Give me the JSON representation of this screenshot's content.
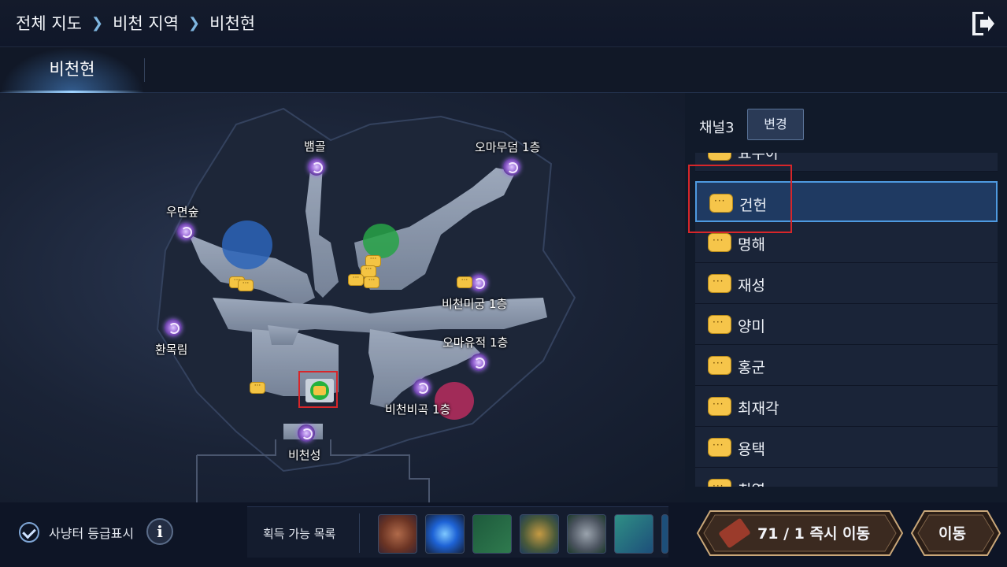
{
  "breadcrumb": [
    "전체 지도",
    "비천 지역",
    "비천현"
  ],
  "tab": {
    "label": "비천현"
  },
  "map": {
    "labels": {
      "baemgol": "뱀골",
      "omamudeom": "오마무덤 1층",
      "umyeonsup": "우면숲",
      "bicheonmigung": "비천미궁 1층",
      "hwanmongnim": "환목림",
      "omayujeok": "오마유적 1층",
      "bicheonbigok": "비천비곡 1층",
      "bicheonseong": "비천성"
    }
  },
  "panel": {
    "channel": "채널3",
    "change_label": "변경",
    "npcs": [
      "요수아",
      "건헌",
      "명해",
      "재성",
      "양미",
      "홍군",
      "최재각",
      "용택",
      "최엽"
    ],
    "selected_index": 1
  },
  "bottom": {
    "grade_display_label": "사냥터 등급표시",
    "acquirable_label": "획득 가능 목록",
    "teleport_count": "71",
    "teleport_max": "1",
    "teleport_label": "즉시 이동",
    "move_label": "이동"
  },
  "colors": {
    "highlight": "#d7262a",
    "accent": "#4e9ae0",
    "npc_bubble": "#f6c54a"
  }
}
